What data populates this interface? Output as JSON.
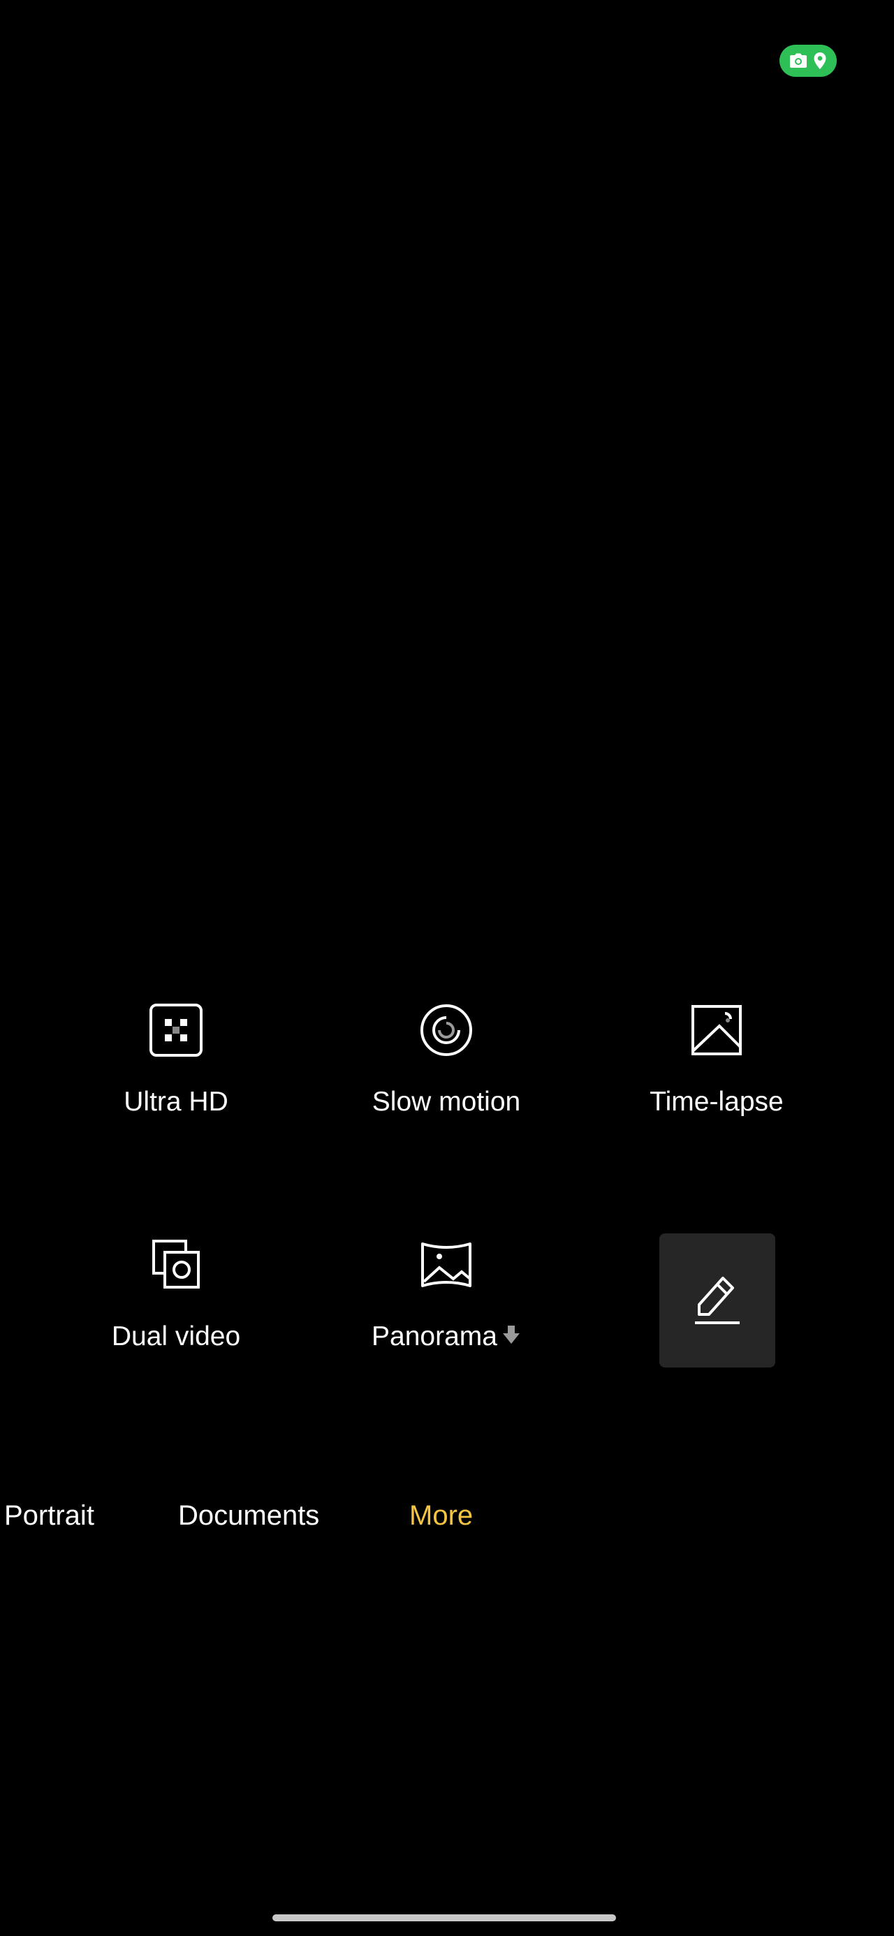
{
  "status": {
    "privacy_icons": [
      "camera-icon",
      "location-icon"
    ],
    "indicator_color": "#2fbf57"
  },
  "modes": [
    {
      "label": "Ultra HD",
      "icon": "ultra-hd-icon"
    },
    {
      "label": "Slow motion",
      "icon": "slow-motion-icon"
    },
    {
      "label": "Time-lapse",
      "icon": "time-lapse-icon"
    },
    {
      "label": "Dual video",
      "icon": "dual-video-icon"
    },
    {
      "label": "Panorama",
      "icon": "panorama-icon",
      "download": true
    }
  ],
  "edit": {
    "icon": "edit-pencil-icon"
  },
  "mode_strip": [
    {
      "label": "Portrait"
    },
    {
      "label": "Documents"
    },
    {
      "label": "More",
      "active": true
    }
  ],
  "colors": {
    "active_mode": "#f5c542",
    "background": "#000000",
    "edit_tile": "#262626"
  }
}
